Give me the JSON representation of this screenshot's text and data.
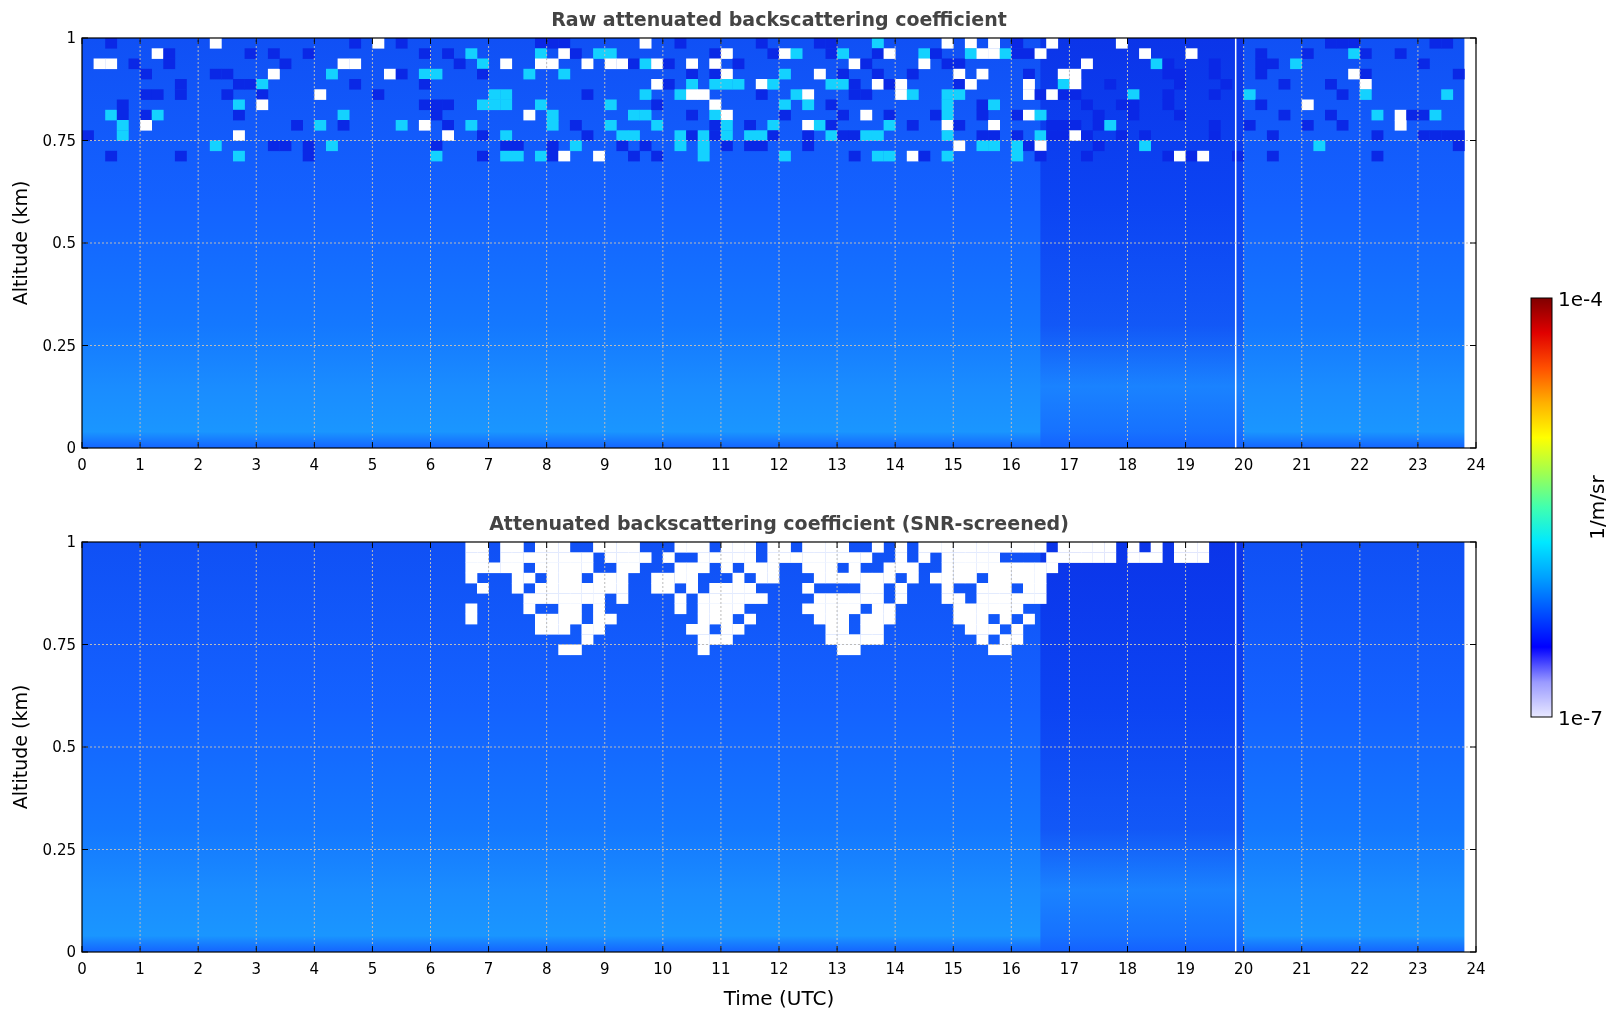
{
  "panels": [
    {
      "title": "Raw attenuated backscattering coefficient",
      "ylabel": "Altitude (km)",
      "yticks": [
        "1",
        "0.75",
        "0.5",
        "0.25",
        "0"
      ],
      "xticks": [
        "0",
        "1",
        "2",
        "3",
        "4",
        "5",
        "6",
        "7",
        "8",
        "9",
        "10",
        "11",
        "12",
        "13",
        "14",
        "15",
        "16",
        "17",
        "18",
        "19",
        "20",
        "21",
        "22",
        "23",
        "24"
      ],
      "screened": false
    },
    {
      "title": "Attenuated backscattering coefficient (SNR-screened)",
      "ylabel": "Altitude (km)",
      "yticks": [
        "1",
        "0.75",
        "0.5",
        "0.25",
        "0"
      ],
      "xticks": [
        "0",
        "1",
        "2",
        "3",
        "4",
        "5",
        "6",
        "7",
        "8",
        "9",
        "10",
        "11",
        "12",
        "13",
        "14",
        "15",
        "16",
        "17",
        "18",
        "19",
        "20",
        "21",
        "22",
        "23",
        "24"
      ],
      "screened": true
    }
  ],
  "xlabel": "Time (UTC)",
  "colorbar": {
    "max": "1e-4",
    "min": "1e-7",
    "label": "1/m/sr"
  }
}
